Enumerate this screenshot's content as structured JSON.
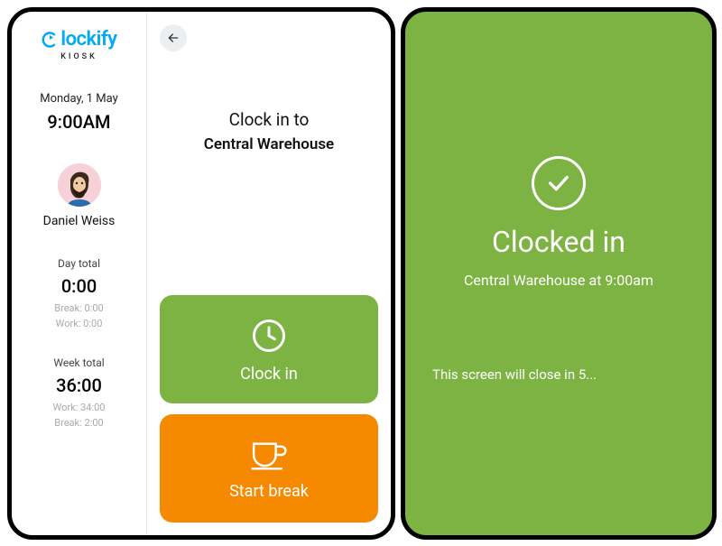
{
  "brand": {
    "name": "lockify",
    "sub": "KIOSK"
  },
  "sidebar": {
    "date": "Monday, 1 May",
    "time": "9:00AM",
    "user_name": "Daniel Weiss",
    "day": {
      "label": "Day total",
      "total": "0:00",
      "row1": "Break: 0:00",
      "row2": "Work: 0:00"
    },
    "week": {
      "label": "Week total",
      "total": "36:00",
      "row1": "Work: 34:00",
      "row2": "Break: 2:00"
    }
  },
  "main": {
    "clockin_prefix": "Clock in to",
    "location": "Central Warehouse",
    "clock_in_label": "Clock in",
    "start_break_label": "Start break"
  },
  "confirm": {
    "title": "Clocked in",
    "subtitle": "Central Warehouse at 9:00am",
    "closing": "This screen will close in 5..."
  },
  "colors": {
    "green": "#7cb342",
    "orange": "#f58a00",
    "brand_blue": "#03a9f4"
  }
}
